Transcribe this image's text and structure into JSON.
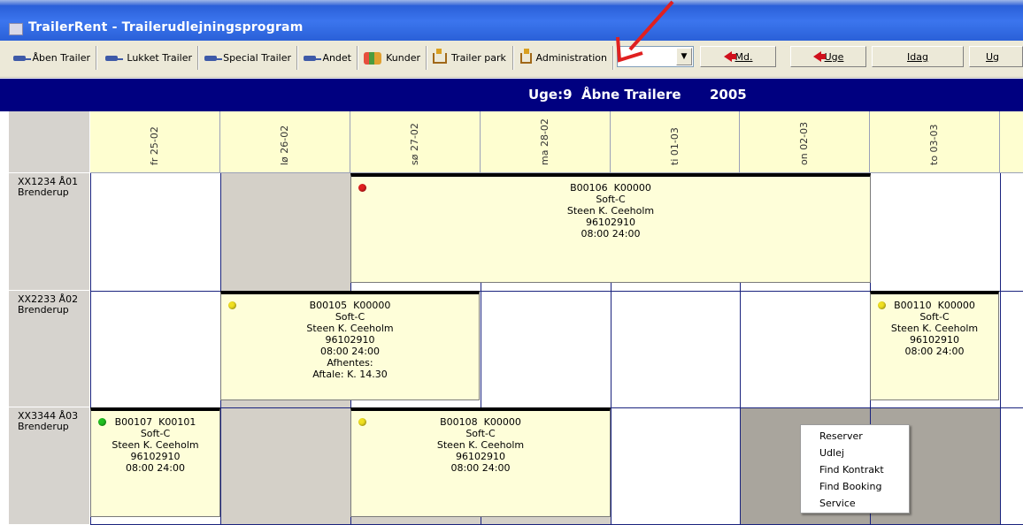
{
  "window": {
    "title": "TrailerRent - Trailerudlejningsprogram"
  },
  "toolbar": {
    "items": [
      {
        "label": "Åben Trailer",
        "icon": "trailer-icon"
      },
      {
        "label": "Lukket Trailer",
        "icon": "trailer-icon"
      },
      {
        "label": "Special Trailer",
        "icon": "trailer-icon"
      },
      {
        "label": "Andet",
        "icon": "trailer-icon"
      },
      {
        "label": "Kunder",
        "icon": "customers-icon"
      },
      {
        "label": "Trailer park",
        "icon": "trailer-park-icon"
      },
      {
        "label": "Administration",
        "icon": "trailer-park-icon"
      }
    ],
    "combo_value": "",
    "nav": [
      {
        "label": "Md.",
        "icon": "red-arrow-left-icon"
      },
      {
        "label": "Uge",
        "icon": "red-arrow-left-icon"
      },
      {
        "label": "Idag"
      },
      {
        "label": "Ug"
      }
    ]
  },
  "banner": {
    "week": "Uge:9",
    "category": "Åbne Trailere",
    "year": "2005"
  },
  "columns": [
    "fr 25-02",
    "lø 26-02",
    "sø 27-02",
    "ma 28-02",
    "ti 01-03",
    "on 02-03",
    "to 03-03"
  ],
  "rows": [
    {
      "code": "XX1234 Å01",
      "brand": "Brenderup"
    },
    {
      "code": "XX2233 Å02",
      "brand": "Brenderup"
    },
    {
      "code": "XX3344 Å03",
      "brand": "Brenderup"
    }
  ],
  "bookings": [
    {
      "id": "B00106",
      "customer": "K00000",
      "company": "Soft-C",
      "name": "Steen K. Ceeholm",
      "phone": "96102910",
      "time": "08:00  24:00",
      "status_color": "#e02020"
    },
    {
      "id": "B00105",
      "customer": "K00000",
      "company": "Soft-C",
      "name": "Steen K.  Ceeholm",
      "phone": "96102910",
      "time": "08:00  24:00",
      "note1": "Afhentes:",
      "note2": "Aftale: K. 14.30",
      "status_color": "#f0e020"
    },
    {
      "id": "B00110",
      "customer": "K00000",
      "company": "Soft-C",
      "name": "Steen K.  Ceeholm",
      "phone": "96102910",
      "time": "08:00  24:00",
      "status_color": "#f0e020"
    },
    {
      "id": "B00107",
      "customer": "K00101",
      "company": "Soft-C",
      "name": "Steen K. Ceeholm",
      "phone": "96102910",
      "time": "08:00  24:00",
      "status_color": "#20c020"
    },
    {
      "id": "B00108",
      "customer": "K00000",
      "company": "Soft-C",
      "name": "Steen K. Ceeholm",
      "phone": "96102910",
      "time": "08:00  24:00",
      "status_color": "#f0e020"
    }
  ],
  "context_menu": [
    "Reserver",
    "Udlej",
    "Find Kontrakt",
    "Find Booking",
    "Service"
  ],
  "colors": {
    "banner": "#000080",
    "booking_bg": "#fefed9",
    "header_bg": "#fefed0",
    "grid_line": "#1a237e",
    "callout": "#e02020"
  }
}
